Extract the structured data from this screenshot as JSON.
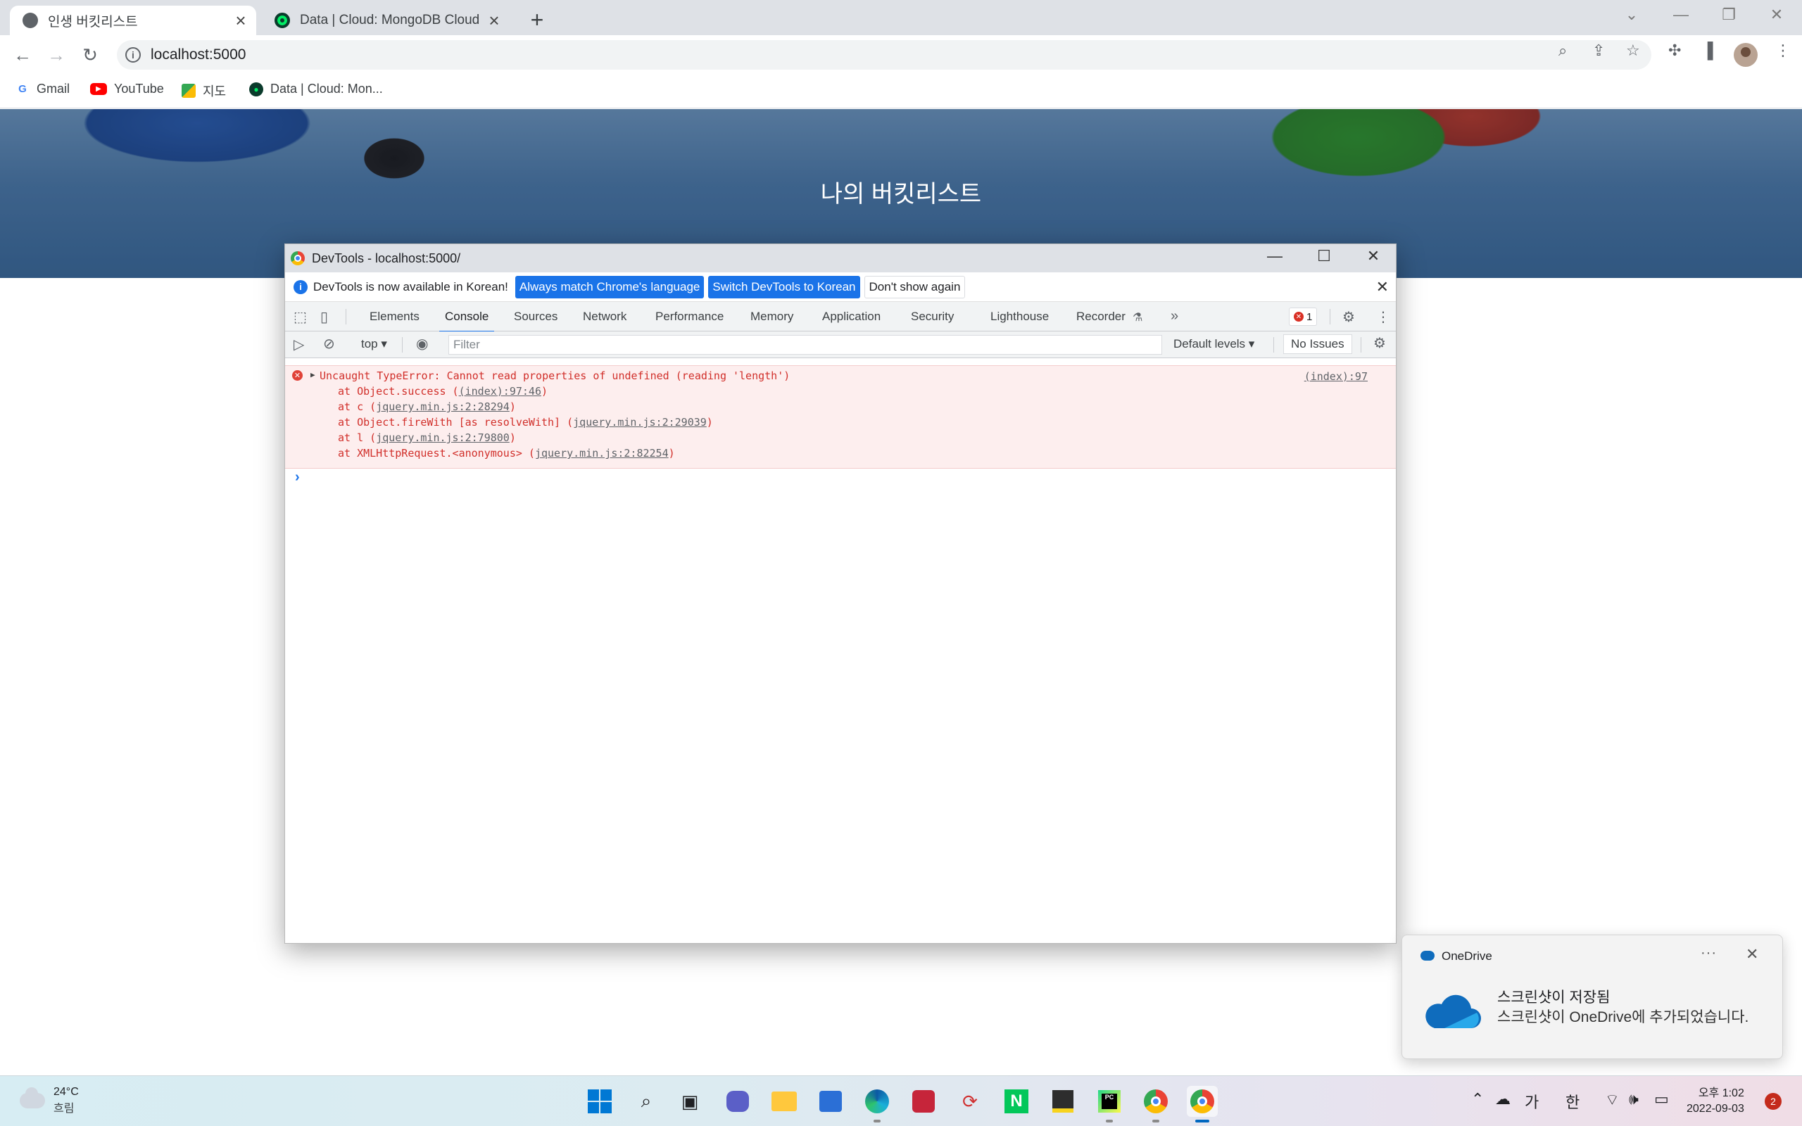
{
  "browser": {
    "tabs": [
      {
        "title": "인생 버킷리스트",
        "icon": "globe-icon",
        "active": true
      },
      {
        "title": "Data | Cloud: MongoDB Cloud",
        "icon": "mongodb-leaf-icon",
        "active": false
      }
    ],
    "url": "localhost:5000",
    "bookmarks": [
      {
        "label": "Gmail",
        "icon": "gmail-icon"
      },
      {
        "label": "YouTube",
        "icon": "youtube-icon"
      },
      {
        "label": "지도",
        "icon": "maps-icon"
      },
      {
        "label": "Data | Cloud: Mon...",
        "icon": "mongodb-leaf-icon"
      }
    ]
  },
  "page": {
    "title": "나의 버킷리스트"
  },
  "devtools": {
    "window_title": "DevTools - localhost:5000/",
    "infobar": {
      "message": "DevTools is now available in Korean!",
      "btn_match": "Always match Chrome's language",
      "btn_switch": "Switch DevTools to Korean",
      "btn_dismiss": "Don't show again"
    },
    "tabs": [
      "Elements",
      "Console",
      "Sources",
      "Network",
      "Performance",
      "Memory",
      "Application",
      "Security",
      "Lighthouse",
      "Recorder"
    ],
    "active_tab": "Console",
    "error_count": "1",
    "console_toolbar": {
      "context": "top",
      "filter_placeholder": "Filter",
      "levels": "Default levels",
      "issues": "No Issues"
    },
    "error": {
      "message": "Uncaught TypeError: Cannot read properties of undefined (reading 'length')",
      "source": "(index):97",
      "stack": [
        {
          "prefix": "at Object.success (",
          "link": "(index):97:46",
          "suffix": ")"
        },
        {
          "prefix": "at c (",
          "link": "jquery.min.js:2:28294",
          "suffix": ")"
        },
        {
          "prefix": "at Object.fireWith [as resolveWith] (",
          "link": "jquery.min.js:2:29039",
          "suffix": ")"
        },
        {
          "prefix": "at l (",
          "link": "jquery.min.js:2:79800",
          "suffix": ")"
        },
        {
          "prefix": "at XMLHttpRequest.<anonymous> (",
          "link": "jquery.min.js:2:82254",
          "suffix": ")"
        }
      ]
    }
  },
  "toast": {
    "app": "OneDrive",
    "title": "스크린샷이 저장됨",
    "body": "스크린샷이 OneDrive에 추가되었습니다."
  },
  "taskbar": {
    "temperature": "24°C",
    "condition": "흐림",
    "ime_1": "가",
    "ime_2": "한",
    "time": "오후 1:02",
    "date": "2022-09-03",
    "notification_count": "2"
  },
  "colors": {
    "accent": "#1a73e8",
    "error_text": "#d12f2a",
    "error_bg": "#fdeeee"
  }
}
